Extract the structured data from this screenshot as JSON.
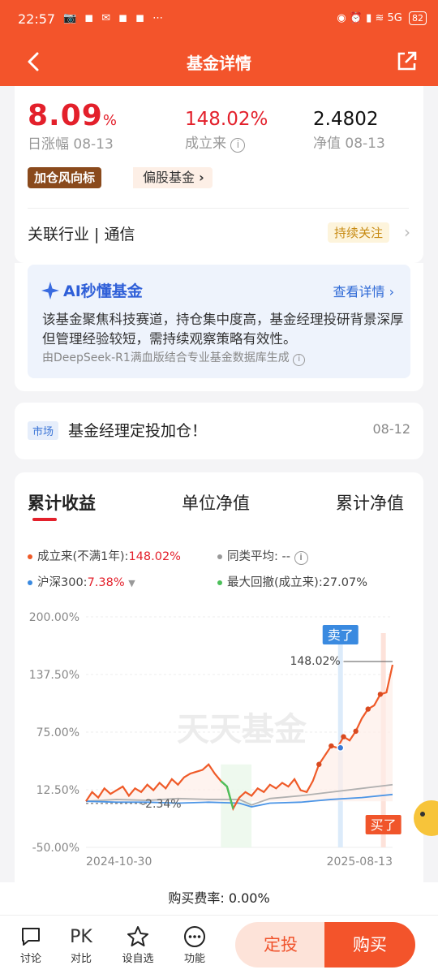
{
  "status_bar": {
    "time": "22:57",
    "app_icons": "📷 ◼ ✉ ◼ ◼ ⋯",
    "network": "5G",
    "battery": "82"
  },
  "nav": {
    "title": "基金详情"
  },
  "summary": {
    "daily_change": "8.09",
    "daily_change_unit": "%",
    "daily_label": "日涨幅 08-13",
    "since_inception": "148.02%",
    "since_label": "成立来",
    "nav_value": "2.4802",
    "nav_label": "净值 08-13",
    "tag_primary": "加仓风向标",
    "tag_secondary": "偏股基金",
    "industry": "关联行业 | 通信",
    "industry_action": "持续关注"
  },
  "ai": {
    "title": "AI秒懂基金",
    "link": "查看详情",
    "text": "该基金聚焦科技赛道，持仓集中度高，基金经理投研背景深厚但管理经验较短，需持续观察策略有效性。",
    "footer": "由DeepSeek-R1满血版结合专业基金数据库生成"
  },
  "news": {
    "badge": "市场",
    "title": "基金经理定投加仓！",
    "date": "08-12"
  },
  "chart_tabs": [
    "累计收益",
    "单位净值",
    "累计净值"
  ],
  "legend": {
    "fund_label": "成立来(不满1年):",
    "fund_value": "148.02%",
    "peer_label": "同类平均:",
    "peer_value": "--",
    "index_label": "沪深300:",
    "index_value": "7.38%",
    "drawdown_label": "最大回撤(成立来):",
    "drawdown_value": "27.07%"
  },
  "chart_data": {
    "type": "line",
    "yticks": [
      "200.00%",
      "137.50%",
      "75.00%",
      "12.50%",
      "-50.00%"
    ],
    "ylim": [
      -50,
      200
    ],
    "x_start": "2024-10-30",
    "x_end": "2025-08-13",
    "watermark": "天天基金",
    "annotations": {
      "end_value": "148.02%",
      "low_value": "-2.34%",
      "sell": "卖了",
      "buy": "买了"
    },
    "series": [
      {
        "name": "成立来",
        "color": "#ef5a28",
        "x": [
          0,
          0.02,
          0.04,
          0.06,
          0.08,
          0.1,
          0.12,
          0.14,
          0.16,
          0.18,
          0.2,
          0.22,
          0.24,
          0.26,
          0.28,
          0.3,
          0.32,
          0.34,
          0.36,
          0.38,
          0.4,
          0.42,
          0.44,
          0.46,
          0.48,
          0.5,
          0.52,
          0.54,
          0.56,
          0.58,
          0.6,
          0.62,
          0.64,
          0.66,
          0.68,
          0.7,
          0.72,
          0.74,
          0.76,
          0.78,
          0.8,
          0.82,
          0.84,
          0.86,
          0.88,
          0.9,
          0.92,
          0.94,
          0.96,
          0.98,
          1.0
        ],
        "values": [
          0,
          10,
          4,
          14,
          8,
          12,
          16,
          6,
          14,
          10,
          18,
          12,
          20,
          14,
          24,
          18,
          26,
          30,
          32,
          34,
          40,
          30,
          22,
          16,
          -8,
          4,
          10,
          6,
          14,
          10,
          18,
          14,
          20,
          16,
          24,
          12,
          10,
          22,
          40,
          50,
          60,
          58,
          70,
          66,
          76,
          90,
          100,
          104,
          116,
          118,
          148
        ]
      },
      {
        "name": "沪深300",
        "color": "#4c95e6",
        "x": [
          0,
          0.1,
          0.2,
          0.3,
          0.4,
          0.5,
          0.54,
          0.6,
          0.7,
          0.8,
          0.9,
          1.0
        ],
        "values": [
          0,
          -1,
          -1,
          -2,
          -1,
          -2,
          -6,
          -2,
          -1,
          2,
          4,
          7.38
        ]
      },
      {
        "name": "同类平均",
        "color": "#b0b0b0",
        "x": [
          0,
          0.1,
          0.2,
          0.3,
          0.4,
          0.5,
          0.54,
          0.6,
          0.7,
          0.8,
          0.9,
          1.0
        ],
        "values": [
          0,
          2,
          1,
          3,
          2,
          2,
          -4,
          3,
          6,
          10,
          14,
          18
        ]
      }
    ]
  },
  "fee": "购买费率: 0.00%",
  "bottom_bar": {
    "items": [
      "讨论",
      "对比",
      "设自选",
      "功能"
    ],
    "pk_text": "PK",
    "fixed_btn": "定投",
    "buy_btn": "购买"
  }
}
